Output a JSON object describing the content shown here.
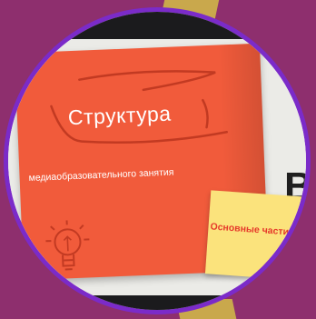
{
  "slide": {
    "title": "Структура",
    "subtitle": "медиаобразовательного занятия",
    "sticky_label": "Основные части",
    "big_letter": "В"
  },
  "colors": {
    "background": "#8e2f6e",
    "ring": "#7b2bc9",
    "red_note": "#f15b3b",
    "yellow_note": "#fbe37c",
    "sticky_text": "#e63a2b",
    "accent_gold": "#c9a84c"
  },
  "icons": {
    "sketch": "scribble-stroke-decoration",
    "bulb": "lightbulb-icon"
  }
}
